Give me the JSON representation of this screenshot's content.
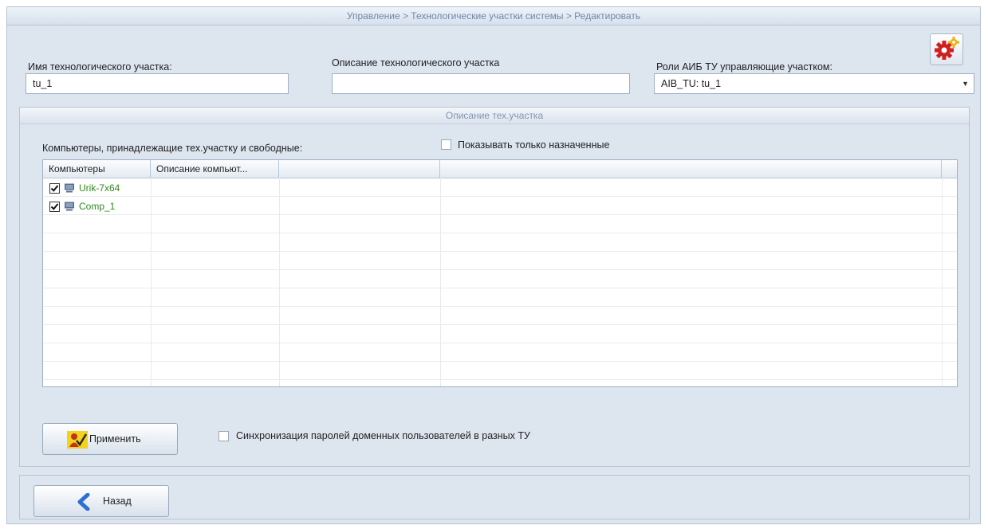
{
  "breadcrumb": "Управление > Технологические участки системы > Редактировать",
  "form": {
    "name_label": "Имя технологического участка:",
    "name_value": "tu_1",
    "description_label": "Описание технологического участка",
    "description_value": "",
    "roles_label": "Роли АИБ ТУ управляющие участком:",
    "roles_value": "AIB_TU: tu_1"
  },
  "section": {
    "title": "Описание тех.участка",
    "computers_label": "Компьютеры, принадлежащие тех.участку и свободные:",
    "show_assigned_label": "Показывать только назначенные",
    "show_assigned_checked": false
  },
  "grid": {
    "columns": [
      "Компьютеры",
      "Описание компьют...",
      "",
      ""
    ],
    "rows": [
      {
        "checked": true,
        "name": "Urik-7x64",
        "description": ""
      },
      {
        "checked": true,
        "name": "Comp_1",
        "description": ""
      }
    ]
  },
  "actions": {
    "apply_label": "Применить",
    "sync_label": "Синхронизация паролей доменных пользователей в разных ТУ",
    "sync_checked": false,
    "back_label": "Назад"
  },
  "icons": {
    "settings": "gear-icon",
    "computer": "computer-icon",
    "apply": "apply-user-icon",
    "back": "chevron-left-icon"
  },
  "colors": {
    "computer_name": "#2e8b1e",
    "gear": "#d11f1f",
    "back_arrow": "#2d6fd6"
  }
}
